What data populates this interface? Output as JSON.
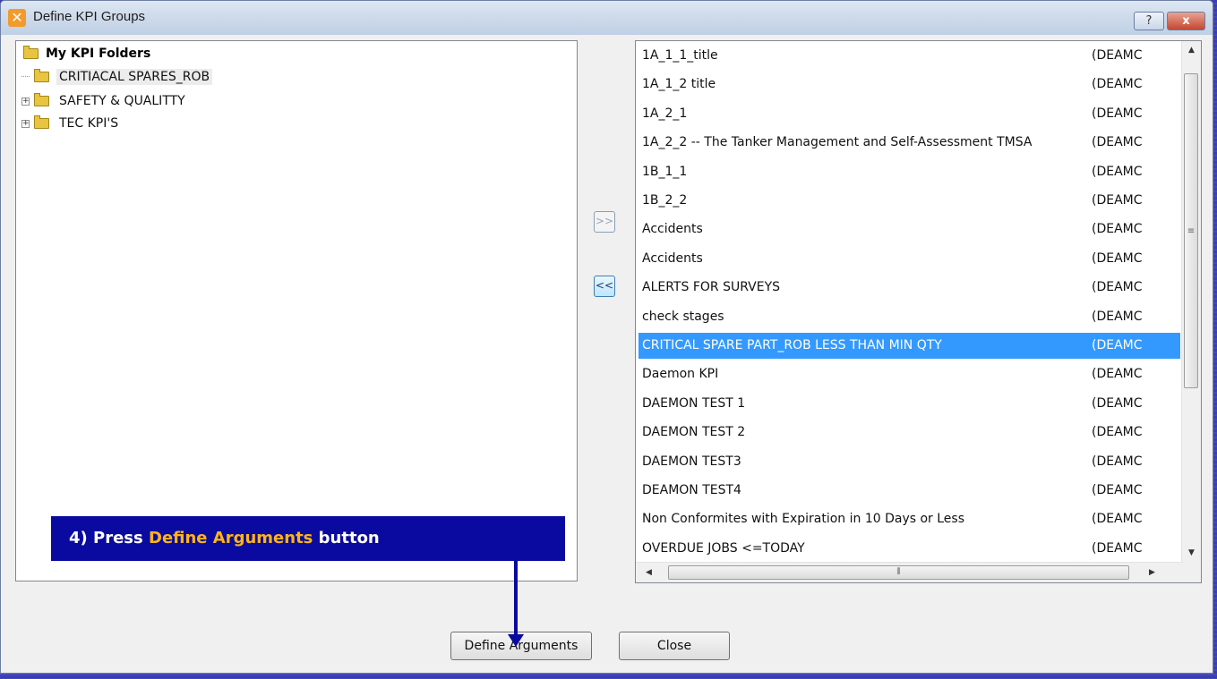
{
  "window": {
    "title": "Define KPI Groups",
    "help_label": "?",
    "close_label": "x"
  },
  "tree": {
    "root_label": "My KPI Folders",
    "items": [
      {
        "label": "CRITIACAL SPARES_ROB",
        "expandable": false,
        "selected": true
      },
      {
        "label": "SAFETY & QUALITTY",
        "expandable": true,
        "selected": false
      },
      {
        "label": "TEC KPI'S",
        "expandable": true,
        "selected": false
      }
    ]
  },
  "move_buttons": {
    "add_label": ">>",
    "remove_label": "<<"
  },
  "kpi_list": {
    "rows": [
      {
        "name": "1A_1_1_title",
        "owner": "(DEAMC"
      },
      {
        "name": "1A_1_2 title",
        "owner": "(DEAMC"
      },
      {
        "name": "1A_2_1",
        "owner": "(DEAMC"
      },
      {
        "name": "1A_2_2  --  The Tanker Management and Self-Assessment TMSA",
        "owner": "(DEAMC"
      },
      {
        "name": "1B_1_1",
        "owner": "(DEAMC"
      },
      {
        "name": "1B_2_2",
        "owner": "(DEAMC"
      },
      {
        "name": "Accidents",
        "owner": "(DEAMC"
      },
      {
        "name": "Accidents",
        "owner": "(DEAMC"
      },
      {
        "name": "ALERTS FOR SURVEYS",
        "owner": "(DEAMC"
      },
      {
        "name": "check stages",
        "owner": "(DEAMC"
      },
      {
        "name": "CRITICAL SPARE PART_ROB LESS THAN MIN QTY",
        "owner": "(DEAMC"
      },
      {
        "name": "Daemon KPI",
        "owner": "(DEAMC"
      },
      {
        "name": "DAEMON TEST 1",
        "owner": "(DEAMC"
      },
      {
        "name": "DAEMON TEST 2",
        "owner": "(DEAMC"
      },
      {
        "name": "DAEMON TEST3",
        "owner": "(DEAMC"
      },
      {
        "name": "DEAMON TEST4",
        "owner": "(DEAMC"
      },
      {
        "name": "Non Conformites with Expiration in 10 Days or Less",
        "owner": "(DEAMC"
      },
      {
        "name": "OVERDUE JOBS <=TODAY",
        "owner": "(DEAMC"
      }
    ],
    "selected_index": 10
  },
  "buttons": {
    "define_arguments": "Define Arguments",
    "close": "Close"
  },
  "callout": {
    "prefix": "4) Press ",
    "highlight": "Define Arguments",
    "suffix": " button"
  },
  "colors": {
    "callout_bg": "#0a0aa0",
    "callout_highlight": "#ffb414",
    "selection": "#3399ff"
  }
}
